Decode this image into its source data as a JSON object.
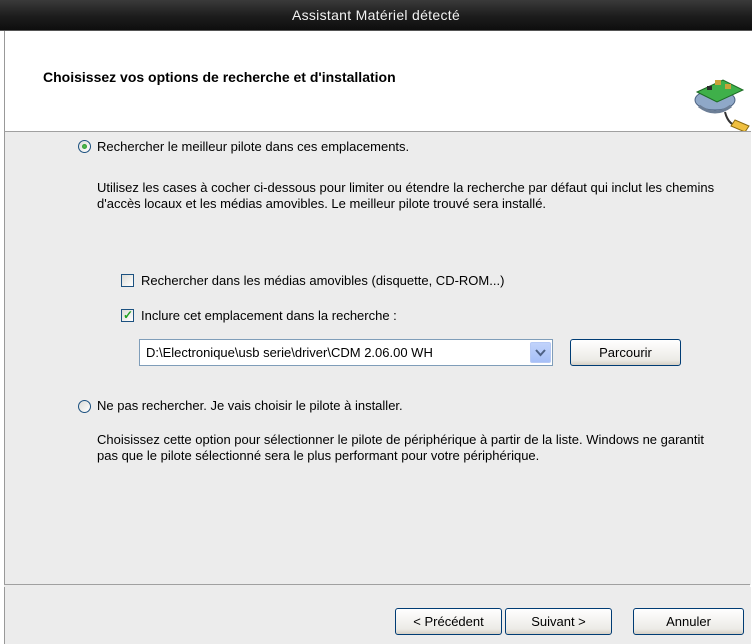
{
  "window": {
    "title": "Assistant Matériel détecté"
  },
  "header": {
    "title": "Choisissez vos options de recherche et d'installation",
    "icon": "hardware-install-icon"
  },
  "options": {
    "search": {
      "label": "Rechercher le meilleur pilote dans ces emplacements.",
      "selected": true,
      "description": "Utilisez les cases à cocher ci-dessous pour limiter ou étendre la recherche par défaut qui inclut les chemins d'accès locaux et les médias amovibles. Le meilleur pilote trouvé sera installé.",
      "removable_label": "Rechercher dans les médias amovibles (disquette, CD-ROM...)",
      "removable_checked": false,
      "include_label": "Inclure cet emplacement dans la recherche :",
      "include_checked": true,
      "path_value": "D:\\Electronique\\usb serie\\driver\\CDM 2.06.00 WH",
      "browse_label": "Parcourir"
    },
    "manual": {
      "label": "Ne pas rechercher. Je vais choisir le pilote à installer.",
      "selected": false,
      "description": "Choisissez cette option pour sélectionner le pilote de périphérique à partir de la liste. Windows ne garantit pas que le pilote sélectionné sera le plus performant pour votre périphérique."
    }
  },
  "footer": {
    "back_label": "< Précédent",
    "next_label": "Suivant >",
    "cancel_label": "Annuler"
  }
}
